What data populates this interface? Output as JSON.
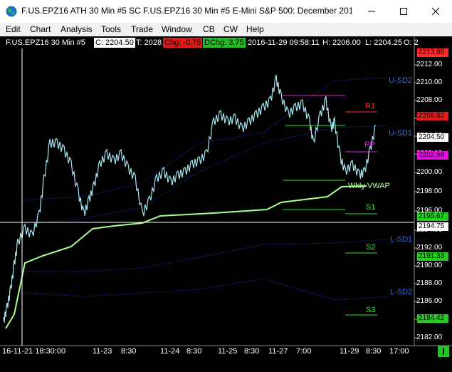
{
  "window": {
    "title": "F.US.EPZ16 ATH 30 Min #5  SC F.US.EPZ16  30 Min   #5  E-Mini S&P 500: December 201..."
  },
  "menu": [
    "Edit",
    "Chart",
    "Analysis",
    "Tools",
    "Trade",
    "Window",
    "CB",
    "CW",
    "Help"
  ],
  "infobar": {
    "symbol": "F.US.EPZ16  30 Min   #5",
    "close": "C: 2204.50",
    "ticks": "T: 2028",
    "chg": "Chg: -0.75",
    "dchg": "DChg: 3.75",
    "datetime": "2016-11-29 09:58:11",
    "high": "H: 2206.00",
    "low": "L: 2204.25",
    "open": "O: 2"
  },
  "price_axis": [
    "2212.00",
    "2210.00",
    "2208.00",
    "2206.00",
    "2204.00",
    "2202.00",
    "2200.00",
    "2198.00",
    "2196.00",
    "2194.00",
    "2192.00",
    "2190.00",
    "2188.00",
    "2186.00",
    "2184.00",
    "2182.00"
  ],
  "price_tags": [
    {
      "text": "2213.88",
      "bg": "#ff2a2a",
      "fg": "#000000"
    },
    {
      "text": "2206.92",
      "bg": "#e81919",
      "fg": "#000000"
    },
    {
      "text": "2204.50",
      "bg": "#ffffff",
      "fg": "#000000"
    },
    {
      "text": "2202.58",
      "bg": "#e010e0",
      "fg": "#000000"
    },
    {
      "text": "2195.67",
      "bg": "#22cc22",
      "fg": "#000000"
    },
    {
      "text": "2194.75",
      "bg": "#ffffff",
      "fg": "#000000"
    },
    {
      "text": "2191.33",
      "bg": "#22cc22",
      "fg": "#000000"
    },
    {
      "text": "2184.42",
      "bg": "#22cc22",
      "fg": "#000000"
    }
  ],
  "levels": [
    {
      "label": "U-SD2",
      "color": "#3a6fd8"
    },
    {
      "label": "R1",
      "color": "#ff3030"
    },
    {
      "label": "U-SD1",
      "color": "#3a6fd8"
    },
    {
      "label": "PP",
      "color": "#e020e0"
    },
    {
      "label": "Wkly VWAP",
      "color": "#b8ffa0"
    },
    {
      "label": "S1",
      "color": "#22ee22"
    },
    {
      "label": "L-SD1",
      "color": "#3a6fd8"
    },
    {
      "label": "S2",
      "color": "#22ee22"
    },
    {
      "label": "L-SD2",
      "color": "#3a6fd8"
    },
    {
      "label": "S3",
      "color": "#22ee22"
    }
  ],
  "time_axis": [
    "16-11-21  18:30:00",
    "11-23",
    "8:30",
    "11-24",
    "8:30",
    "11-25",
    "8:30",
    "11-27",
    "7:00",
    "11-29",
    "8:30",
    "17:00"
  ],
  "colors": {
    "price": "#a8e8f0",
    "vwap": "#a8ff90",
    "band": "#2244dd",
    "crosshair": "#ffffff"
  }
}
